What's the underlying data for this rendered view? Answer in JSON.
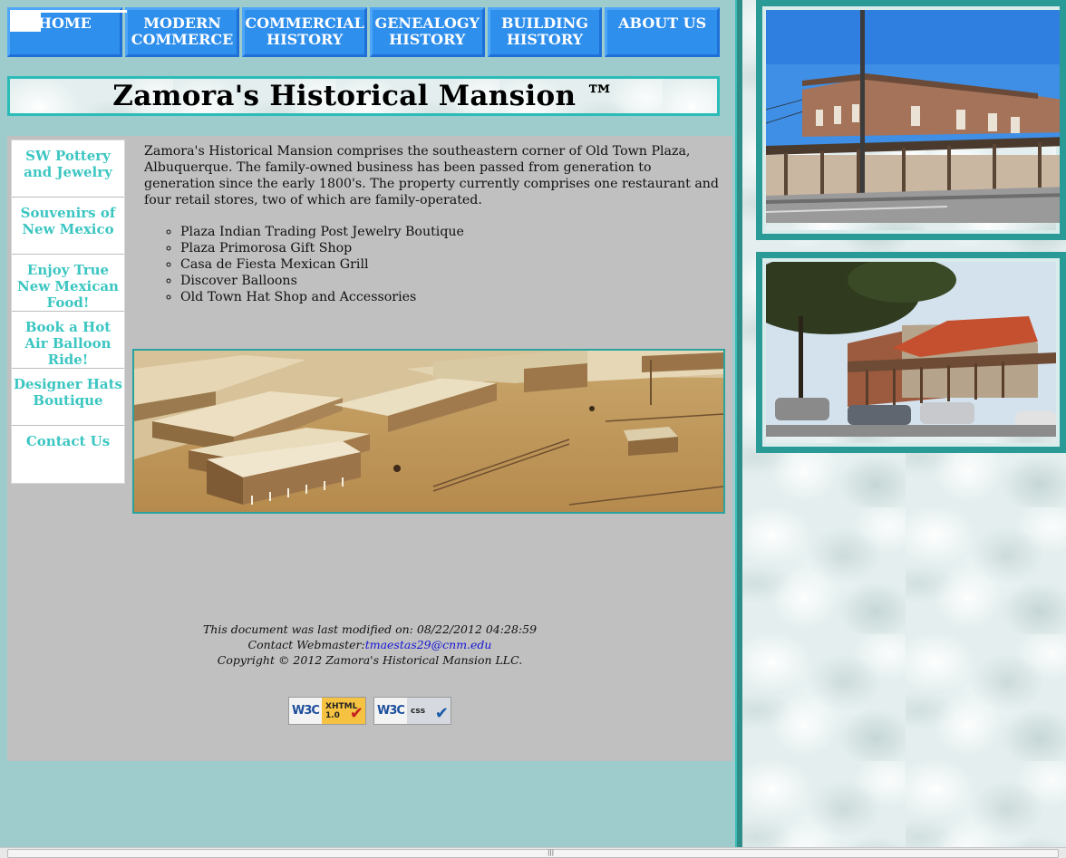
{
  "nav": {
    "items": [
      {
        "line1": "HOME",
        "line2": ""
      },
      {
        "line1": "MODERN",
        "line2": "COMMERCE"
      },
      {
        "line1": "COMMERCIAL",
        "line2": "HISTORY"
      },
      {
        "line1": "GENEALOGY",
        "line2": "HISTORY"
      },
      {
        "line1": "BUILDING",
        "line2": "HISTORY"
      },
      {
        "line1": "ABOUT US",
        "line2": ""
      }
    ]
  },
  "title": "Zamora's Historical Mansion ™",
  "sidebar": {
    "items": [
      {
        "label": "SW Pottery and Jewelry"
      },
      {
        "label": "Souvenirs of New Mexico"
      },
      {
        "label": "Enjoy True New Mexican Food!"
      },
      {
        "label": "Book a Hot Air Balloon Ride!"
      },
      {
        "label": "Designer Hats Boutique"
      },
      {
        "label": "Contact Us"
      }
    ]
  },
  "intro": "Zamora's Historical Mansion comprises the southeastern corner of Old Town Plaza, Albuquerque. The family-owned business has been passed from generation to generation since the early 1800's. The property currently comprises one restaurant and four retail stores, two of which are family-operated.",
  "shops": [
    "Plaza Indian Trading Post Jewelry Boutique",
    "Plaza Primorosa Gift Shop",
    "Casa de Fiesta Mexican Grill",
    "Discover Balloons",
    "Old Town Hat Shop and Accessories"
  ],
  "footer": {
    "modified_label": "This document was last modified on: 08/22/2012 04:28:59",
    "contact_label": "Contact Webmaster:",
    "contact_email": "tmaestas29@cnm.edu",
    "copyright": "Copyright © 2012 Zamora's Historical Mansion LLC."
  },
  "badges": {
    "w3c": "W3C",
    "xhtml_line1": "XHTML",
    "xhtml_line2": "1.0",
    "css": "css",
    "tick": "✔"
  },
  "colors": {
    "page_bg": "#9ecccc",
    "nav_blue": "#2f8fec",
    "content_gray": "#c0c0c0",
    "sidebar_link": "#3cc6c2",
    "frame_teal": "#2a9a96",
    "link_blue": "#1515d6"
  },
  "icons": {
    "scroll_grip": "|||"
  }
}
